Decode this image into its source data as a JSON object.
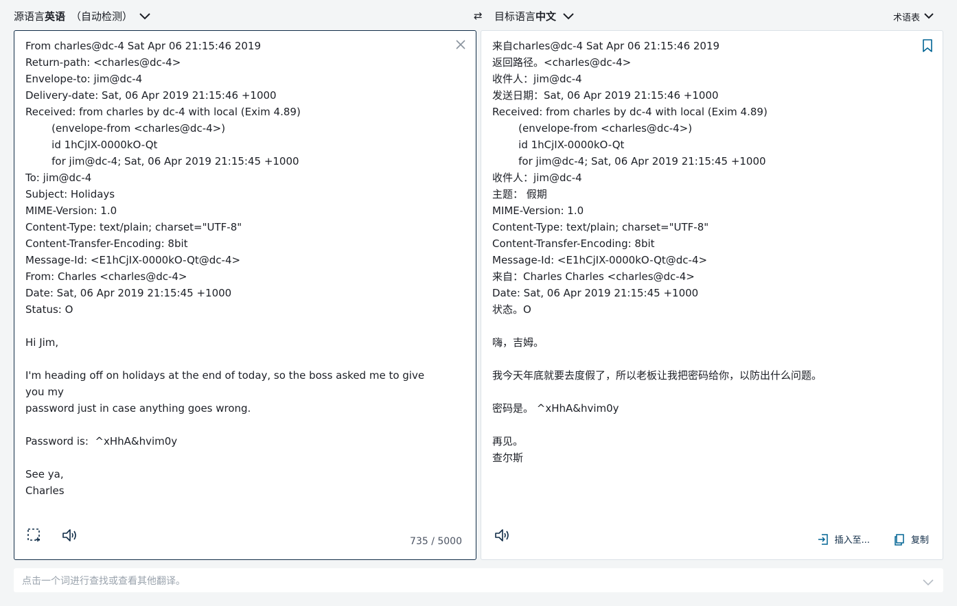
{
  "header": {
    "source_lang_prefix": "源语言",
    "source_lang": "英语",
    "source_detect": "（自动检测）",
    "swap_symbol": "⇄",
    "target_lang_prefix": "目标语言",
    "target_lang": "中文",
    "glossary": "术语表"
  },
  "source": {
    "text": "From charles@dc-4 Sat Apr 06 21:15:46 2019\nReturn-path: <charles@dc-4>\nEnvelope-to: jim@dc-4\nDelivery-date: Sat, 06 Apr 2019 21:15:46 +1000\nReceived: from charles by dc-4 with local (Exim 4.89)\n        (envelope-from <charles@dc-4>)\n        id 1hCjIX-0000kO-Qt\n        for jim@dc-4; Sat, 06 Apr 2019 21:15:45 +1000\nTo: jim@dc-4\nSubject: Holidays\nMIME-Version: 1.0\nContent-Type: text/plain; charset=\"UTF-8\"\nContent-Transfer-Encoding: 8bit\nMessage-Id: <E1hCjIX-0000kO-Qt@dc-4>\nFrom: Charles <charles@dc-4>\nDate: Sat, 06 Apr 2019 21:15:45 +1000\nStatus: O\n\nHi Jim,\n\nI'm heading off on holidays at the end of today, so the boss asked me to give you my\npassword just in case anything goes wrong.\n\nPassword is:  ^xHhA&hvim0y\n\nSee ya,\nCharles",
    "char_count": "735 / 5000"
  },
  "target": {
    "text": "来自charles@dc-4 Sat Apr 06 21:15:46 2019\n返回路径。<charles@dc-4>\n收件人：jim@dc-4\n发送日期：Sat, 06 Apr 2019 21:15:46 +1000\nReceived: from charles by dc-4 with local (Exim 4.89)\n        (envelope-from <charles@dc-4>)\n        id 1hCjIX-0000kO-Qt\n        for jim@dc-4; Sat, 06 Apr 2019 21:15:45 +1000\n收件人：jim@dc-4\n主题： 假期\nMIME-Version: 1.0\nContent-Type: text/plain; charset=\"UTF-8\"\nContent-Transfer-Encoding: 8bit\nMessage-Id: <E1hCjIX-0000kO-Qt@dc-4>\n来自：Charles Charles <charles@dc-4>\nDate: Sat, 06 Apr 2019 21:15:45 +1000\n状态。O\n\n嗨，吉姆。\n\n我今天年底就要去度假了，所以老板让我把密码给你，以防出什么问题。\n\n密码是。 ^xHhA&hvim0y\n\n再见。\n查尔斯",
    "insert_label": "插入至...",
    "copy_label": "复制"
  },
  "dictionary": {
    "placeholder": "点击一个词进行查找或查看其他翻译。"
  }
}
